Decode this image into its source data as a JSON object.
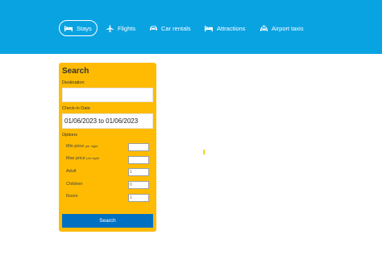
{
  "nav": {
    "items": [
      {
        "label": "Stays",
        "icon": "bed-icon"
      },
      {
        "label": "Flights",
        "icon": "plane-icon"
      },
      {
        "label": "Car rentals",
        "icon": "car-icon"
      },
      {
        "label": "Attractions",
        "icon": "bed-icon"
      },
      {
        "label": "Airport taxis",
        "icon": "taxi-icon"
      }
    ]
  },
  "search": {
    "title": "Search",
    "destination_label": "Destination",
    "destination_value": "",
    "checkin_label": "Check-in Date",
    "checkin_value": "01/06/2023 to 01/06/2023",
    "options_label": "Options",
    "options": {
      "min_price": {
        "label": "Min price",
        "suffix": "per night",
        "value": ""
      },
      "max_price": {
        "label": "Max price",
        "suffix": "per night",
        "value": ""
      },
      "adult": {
        "label": "Adult",
        "value": "1"
      },
      "children": {
        "label": "Children",
        "value": "0"
      },
      "room": {
        "label": "Room",
        "value": "1"
      }
    },
    "button_label": "Search"
  },
  "colors": {
    "header_bg": "#0aa3e2",
    "card_bg": "#febb02",
    "button_bg": "#0071c2"
  }
}
